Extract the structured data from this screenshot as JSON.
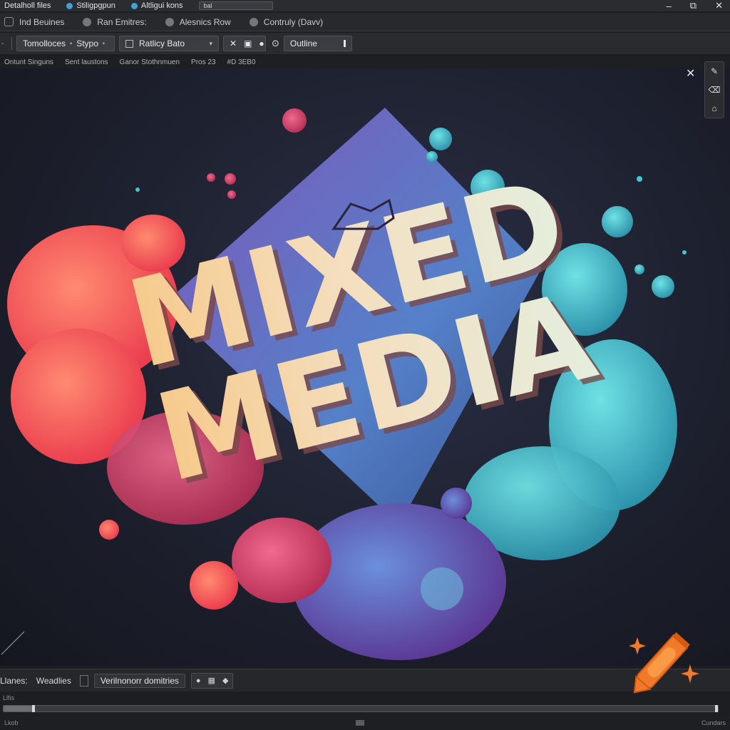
{
  "menubar": {
    "items": [
      "Detalholl files",
      "Stiligpgpun",
      "Altligui kons"
    ],
    "combo_value": "bal"
  },
  "window_controls": {
    "minimize": "–",
    "restore": "⧉",
    "close": "✕"
  },
  "toolbar1": {
    "items": [
      "Ind Beuines",
      "Ran Emitres:",
      "Alesnics Row",
      "Contruly (Davv)"
    ]
  },
  "toolbar2": {
    "mode_label": "Tomolloces",
    "mode_suffix": "Stypo",
    "preset_label": "Ratlicy Bato",
    "outline_label": "Outline"
  },
  "breadcrumb": [
    "Ontunt Singuns",
    "Sent laustons",
    "Ganor Stothnmuen",
    "Pros 23",
    "#D 3EB0"
  ],
  "artwork": {
    "line1": "MIXED",
    "line2": "MEDIA",
    "colors": {
      "coral": "#ff6a5a",
      "pink": "#e34f7a",
      "teal": "#46c6cf",
      "purple": "#6a5ac8",
      "cream": "#f2d9b0"
    }
  },
  "side_tools": [
    "brush-icon",
    "eraser-icon",
    "stamp-icon"
  ],
  "statusbar": {
    "label1": "Llanes:",
    "label2": "Weadlies",
    "field_value": "Verilnonorr domitries",
    "hint": "Llfis"
  },
  "timeline": {
    "progress": 0.04
  },
  "footer": {
    "left": "Lkob",
    "right": "Cundars"
  },
  "accent_colors": {
    "panel": "#2b2c30",
    "canvas": "#1c1f2c",
    "logo_orange": "#f07a2a"
  }
}
